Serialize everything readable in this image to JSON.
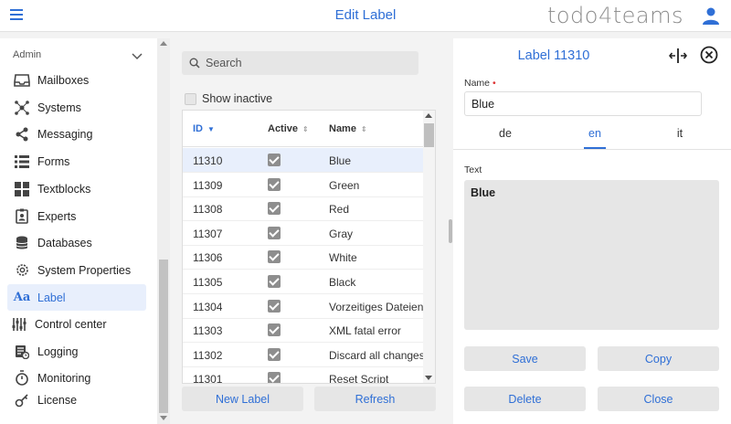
{
  "header": {
    "title": "Edit Label",
    "brand_pre": "todo",
    "brand_num": "4",
    "brand_post": "teams"
  },
  "sidebar": {
    "section": "Admin",
    "items": [
      {
        "label": "Mailboxes",
        "icon": "inbox-icon"
      },
      {
        "label": "Systems",
        "icon": "network-icon"
      },
      {
        "label": "Messaging",
        "icon": "share-icon"
      },
      {
        "label": "Forms",
        "icon": "list-icon"
      },
      {
        "label": "Textblocks",
        "icon": "grid-icon"
      },
      {
        "label": "Experts",
        "icon": "badge-icon"
      },
      {
        "label": "Databases",
        "icon": "database-icon"
      },
      {
        "label": "System Properties",
        "icon": "gear-icon"
      },
      {
        "label": "Label",
        "icon": "font-icon",
        "active": true
      },
      {
        "label": "Control center",
        "icon": "sliders-icon"
      },
      {
        "label": "Logging",
        "icon": "log-icon"
      },
      {
        "label": "Monitoring",
        "icon": "timer-icon"
      },
      {
        "label": "License",
        "icon": "key-icon"
      }
    ]
  },
  "list": {
    "search_placeholder": "Search",
    "show_inactive": "Show inactive",
    "columns": {
      "id": "ID",
      "active": "Active",
      "name": "Name"
    },
    "rows": [
      {
        "id": "11310",
        "name": "Blue",
        "selected": true
      },
      {
        "id": "11309",
        "name": "Green"
      },
      {
        "id": "11308",
        "name": "Red"
      },
      {
        "id": "11307",
        "name": "Gray"
      },
      {
        "id": "11306",
        "name": "White"
      },
      {
        "id": "11305",
        "name": "Black"
      },
      {
        "id": "11304",
        "name": "Vorzeitiges Dateiende"
      },
      {
        "id": "11303",
        "name": "XML fatal error"
      },
      {
        "id": "11302",
        "name": "Discard all changes?"
      },
      {
        "id": "11301",
        "name": "Reset Script"
      }
    ],
    "new_button": "New Label",
    "refresh_button": "Refresh"
  },
  "detail": {
    "title": "Label 11310",
    "name_label": "Name",
    "required_mark": "•",
    "name_value": "Blue",
    "tabs": [
      "de",
      "en",
      "it"
    ],
    "active_tab": "en",
    "text_label": "Text",
    "text_value": "Blue",
    "buttons": {
      "save": "Save",
      "copy": "Copy",
      "delete": "Delete",
      "close": "Close"
    }
  },
  "colors": {
    "accent": "#2f6fd6",
    "selected_row": "#e8effc",
    "panel_bg": "#e6e6e6"
  }
}
